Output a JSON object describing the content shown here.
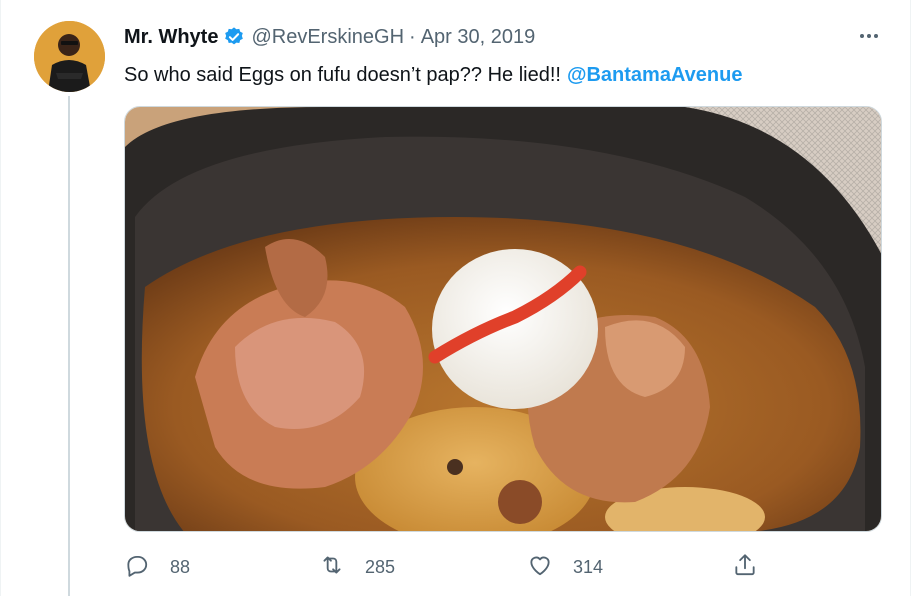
{
  "tweet": {
    "author": {
      "display_name": "Mr. Whyte",
      "handle": "@RevErskineGH",
      "verified": true,
      "avatar_icon": "profile-photo"
    },
    "separator": "·",
    "date": "Apr 30, 2019",
    "text": "So who said Eggs on fufu doesn’t pap?? He lied!!",
    "mention": "@BantamaAvenue",
    "media_icon": "food-photo",
    "actions": {
      "reply_count": "88",
      "retweet_count": "285",
      "like_count": "314",
      "reply_icon": "reply-icon",
      "retweet_icon": "retweet-icon",
      "like_icon": "heart-icon",
      "share_icon": "share-icon",
      "more_icon": "more-options-icon"
    }
  },
  "colors": {
    "link": "#1d9bf0",
    "secondary_text": "#536471",
    "primary_text": "#0f1419",
    "verified_badge": "#1d9bf0"
  }
}
